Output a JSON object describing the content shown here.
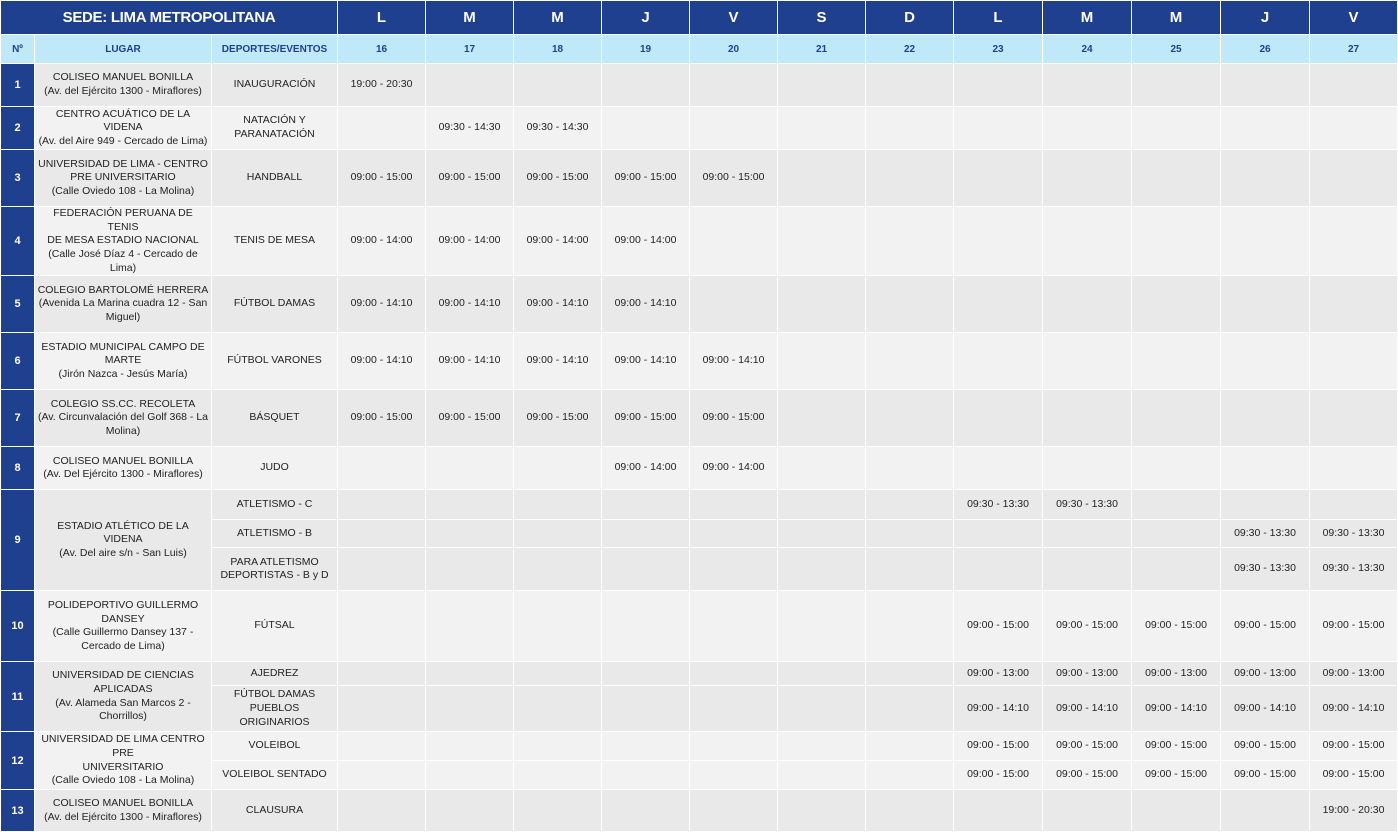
{
  "header": {
    "title": "SEDE: LIMA METROPOLITANA",
    "day_letters": [
      "L",
      "M",
      "M",
      "J",
      "V",
      "S",
      "D",
      "L",
      "M",
      "M",
      "J",
      "V"
    ]
  },
  "subheader": {
    "num": "Nº",
    "place": "LUGAR",
    "sports": "DEPORTES/EVENTOS",
    "dates": [
      "16",
      "17",
      "18",
      "19",
      "20",
      "21",
      "22",
      "23",
      "24",
      "25",
      "26",
      "27"
    ]
  },
  "rows": [
    {
      "n": "1",
      "place": [
        "COLISEO MANUEL BONILLA",
        "(Av. del Ejército 1300 - Miraflores)"
      ],
      "events": [
        {
          "name": [
            "INAUGURACIÓN"
          ],
          "times": {
            "0": "19:00 - 20:30"
          }
        }
      ]
    },
    {
      "n": "2",
      "place": [
        "CENTRO ACUÁTICO DE LA VIDENA",
        "(Av. del Aire 949 - Cercado de Lima)"
      ],
      "events": [
        {
          "name": [
            "NATACIÓN Y",
            "PARANATACIÓN"
          ],
          "times": {
            "1": "09:30 - 14:30",
            "2": "09:30 - 14:30"
          }
        }
      ]
    },
    {
      "n": "3",
      "place": [
        "UNIVERSIDAD DE LIMA - CENTRO",
        "PRE UNIVERSITARIO",
        "(Calle Oviedo 108 - La Molina)"
      ],
      "events": [
        {
          "name": [
            "HANDBALL"
          ],
          "times": {
            "0": "09:00 - 15:00",
            "1": "09:00 - 15:00",
            "2": "09:00 - 15:00",
            "3": "09:00 - 15:00",
            "4": "09:00 - 15:00"
          }
        }
      ]
    },
    {
      "n": "4",
      "place": [
        "FEDERACIÓN PERUANA DE TENIS",
        "DE MESA ESTADIO NACIONAL",
        "(Calle José Díaz 4 - Cercado de Lima)"
      ],
      "events": [
        {
          "name": [
            "TENIS DE MESA"
          ],
          "times": {
            "0": "09:00 - 14:00",
            "1": "09:00 - 14:00",
            "2": "09:00 - 14:00",
            "3": "09:00 - 14:00"
          }
        }
      ]
    },
    {
      "n": "5",
      "place": [
        "COLEGIO BARTOLOMÉ HERRERA",
        "(Avenida La Marina cuadra 12 - San",
        "Miguel)"
      ],
      "events": [
        {
          "name": [
            "FÚTBOL DAMAS"
          ],
          "times": {
            "0": "09:00 - 14:10",
            "1": "09:00 - 14:10",
            "2": "09:00 - 14:10",
            "3": "09:00 - 14:10"
          }
        }
      ]
    },
    {
      "n": "6",
      "place": [
        "ESTADIO MUNICIPAL CAMPO DE",
        "MARTE",
        "(Jirón Nazca - Jesús María)"
      ],
      "events": [
        {
          "name": [
            "FÚTBOL VARONES"
          ],
          "times": {
            "0": "09:00 - 14:10",
            "1": "09:00 - 14:10",
            "2": "09:00 - 14:10",
            "3": "09:00 - 14:10",
            "4": "09:00 - 14:10"
          }
        }
      ]
    },
    {
      "n": "7",
      "place": [
        "COLEGIO SS.CC. RECOLETA",
        "(Av. Circunvalación del Golf 368 - La",
        "Molina)"
      ],
      "events": [
        {
          "name": [
            "BÁSQUET"
          ],
          "times": {
            "0": "09:00 - 15:00",
            "1": "09:00 - 15:00",
            "2": "09:00 - 15:00",
            "3": "09:00 - 15:00",
            "4": "09:00 - 15:00"
          }
        }
      ]
    },
    {
      "n": "8",
      "place": [
        "COLISEO MANUEL BONILLA",
        "(Av. Del Ejército 1300 - Miraflores)"
      ],
      "events": [
        {
          "name": [
            "JUDO"
          ],
          "times": {
            "3": "09:00 - 14:00",
            "4": "09:00 - 14:00"
          }
        }
      ]
    },
    {
      "n": "9",
      "place": [
        "ESTADIO ATLÉTICO DE LA VIDENA",
        "(Av. Del aire s/n - San Luis)"
      ],
      "events": [
        {
          "name": [
            "ATLETISMO - C"
          ],
          "times": {
            "7": "09:30 - 13:30",
            "8": "09:30 - 13:30"
          }
        },
        {
          "name": [
            "ATLETISMO - B"
          ],
          "times": {
            "10": "09:30 - 13:30",
            "11": "09:30 - 13:30"
          }
        },
        {
          "name": [
            "PARA ATLETISMO",
            "DEPORTISTAS - B y D"
          ],
          "times": {
            "10": "09:30 - 13:30",
            "11": "09:30 - 13:30"
          }
        }
      ]
    },
    {
      "n": "10",
      "place": [
        "POLIDEPORTIVO GUILLERMO",
        "DANSEY",
        "(Calle Guillermo Dansey 137 -",
        "Cercado de Lima)"
      ],
      "events": [
        {
          "name": [
            "FÚTSAL"
          ],
          "times": {
            "7": "09:00 - 15:00",
            "8": "09:00 - 15:00",
            "9": "09:00 - 15:00",
            "10": "09:00 - 15:00",
            "11": "09:00 - 15:00"
          }
        }
      ]
    },
    {
      "n": "11",
      "place": [
        "UNIVERSIDAD DE CIENCIAS",
        "APLICADAS",
        "(Av. Alameda San Marcos 2 -",
        "Chorrillos)"
      ],
      "events": [
        {
          "name": [
            "AJEDREZ"
          ],
          "times": {
            "7": "09:00 - 13:00",
            "8": "09:00 - 13:00",
            "9": "09:00 - 13:00",
            "10": "09:00 - 13:00",
            "11": "09:00 - 13:00"
          }
        },
        {
          "name": [
            "FÚTBOL DAMAS",
            "PUEBLOS ORIGINARIOS"
          ],
          "times": {
            "7": "09:00 - 14:10",
            "8": "09:00 - 14:10",
            "9": "09:00 - 14:10",
            "10": "09:00 - 14:10",
            "11": "09:00 - 14:10"
          }
        }
      ]
    },
    {
      "n": "12",
      "place": [
        "UNIVERSIDAD DE LIMA CENTRO PRE",
        "UNIVERSITARIO",
        "(Calle Oviedo 108 - La Molina)"
      ],
      "events": [
        {
          "name": [
            "VOLEIBOL"
          ],
          "times": {
            "7": "09:00 - 15:00",
            "8": "09:00 - 15:00",
            "9": "09:00 - 15:00",
            "10": "09:00 - 15:00",
            "11": "09:00 - 15:00"
          }
        },
        {
          "name": [
            "VOLEIBOL SENTADO"
          ],
          "times": {
            "7": "09:00 - 15:00",
            "8": "09:00 - 15:00",
            "9": "09:00 - 15:00",
            "10": "09:00 - 15:00",
            "11": "09:00 - 15:00"
          }
        }
      ]
    },
    {
      "n": "13",
      "place": [
        "COLISEO MANUEL BONILLA",
        "(Av. del Ejército 1300 - Miraflores)"
      ],
      "events": [
        {
          "name": [
            "CLAUSURA"
          ],
          "times": {
            "11": "19:00 - 20:30"
          }
        }
      ]
    }
  ],
  "colors": {
    "header_bg": "#1f3f8f",
    "subheader_bg": "#bfe9f8",
    "row_odd": "#e9e9e9",
    "row_even": "#f2f2f2"
  }
}
